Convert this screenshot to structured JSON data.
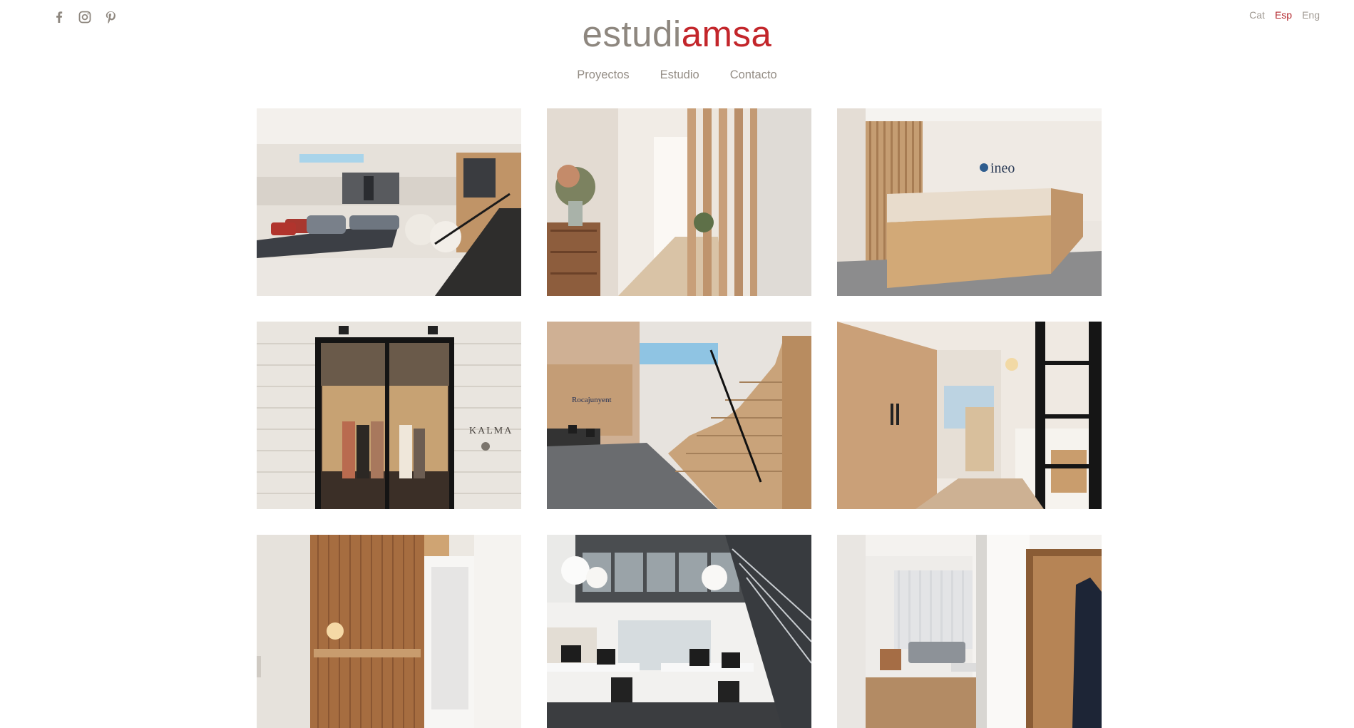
{
  "social": [
    {
      "name": "facebook-icon"
    },
    {
      "name": "instagram-icon"
    },
    {
      "name": "pinterest-icon"
    }
  ],
  "languages": {
    "items": [
      "Cat",
      "Esp",
      "Eng"
    ],
    "active": "Esp"
  },
  "logo": {
    "part1": "estudi",
    "part2": "amsa"
  },
  "nav": {
    "items": [
      "Proyectos",
      "Estudio",
      "Contacto"
    ]
  },
  "colors": {
    "brand_red": "#c3262b",
    "brand_gray": "#8e877f",
    "nav_text": "#948d85",
    "lang_active": "#b3272d"
  },
  "projects": [
    {
      "photo": "lounge-with-staircase",
      "sign": ""
    },
    {
      "photo": "wooden-slat-hallway",
      "sign": ""
    },
    {
      "photo": "reception-desk",
      "sign": "ineo"
    },
    {
      "photo": "boutique-storefront",
      "sign": "KALMA"
    },
    {
      "photo": "office-staircase",
      "sign": "Rocajunyent"
    },
    {
      "photo": "kitchen-with-wood-wall",
      "sign": ""
    },
    {
      "photo": "wood-panel-entrance",
      "sign": ""
    },
    {
      "photo": "open-plan-office",
      "sign": ""
    },
    {
      "photo": "living-room-wardrobe",
      "sign": ""
    }
  ]
}
